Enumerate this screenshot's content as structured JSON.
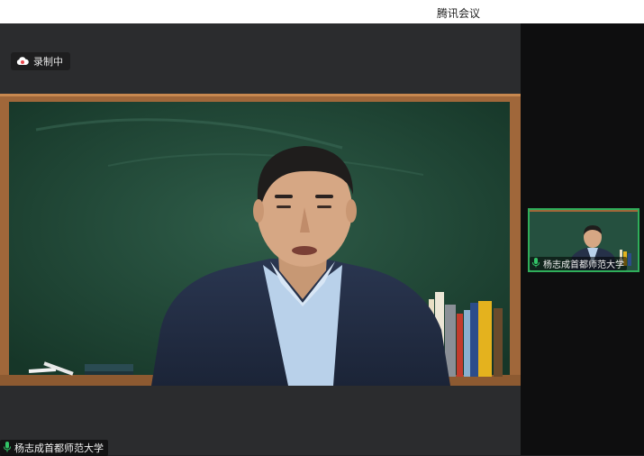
{
  "app": {
    "title": "腾讯会议"
  },
  "recording": {
    "label": "录制中",
    "icon": "cloud-record-icon",
    "icon_color": "#e8474c"
  },
  "speaker": {
    "name": "杨志成首都师范大学",
    "mic_icon": "microphone-icon",
    "mic_color": "#32c467"
  },
  "thumbnail": {
    "name": "杨志成首都师范大学",
    "border_color": "#2fae5a"
  }
}
